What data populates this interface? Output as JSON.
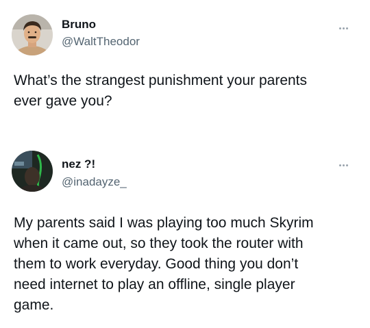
{
  "posts": [
    {
      "display_name": "Bruno",
      "handle": "@WaltTheodor",
      "text": "What’s the strangest punishment your parents\never gave you?",
      "avatar_icon": "profile-photo-icon"
    },
    {
      "display_name": "nez ?!",
      "handle": "@inadayze_",
      "text": "My parents said I was playing too much Skyrim\nwhen it came out, so they took the router with\nthem to work everyday. Good thing you don’t\nneed internet to play an offline, single player\ngame.",
      "avatar_icon": "profile-photo-icon"
    }
  ],
  "colors": {
    "text": "#0f1419",
    "secondary_text": "#536471",
    "more_dots": "#9aa4ad"
  }
}
